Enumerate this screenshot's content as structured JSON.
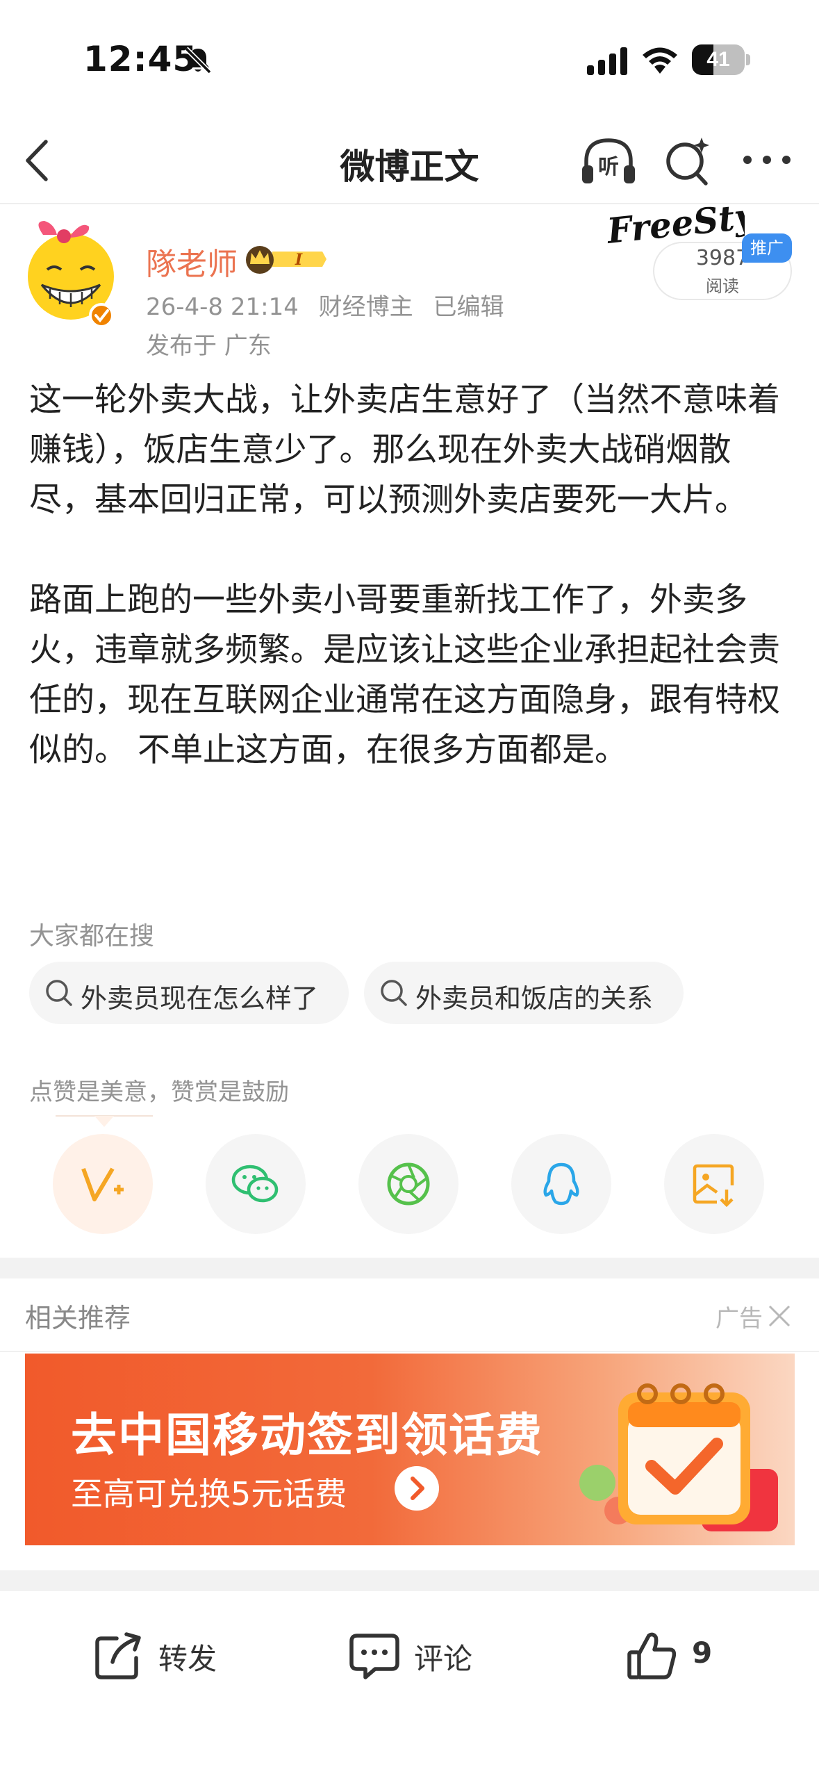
{
  "status_bar": {
    "time": "12:45",
    "battery": "41",
    "battery_level": 0.41,
    "icons": [
      "bell-off-icon",
      "cellular-signal-icon",
      "wifi-icon",
      "battery-icon"
    ]
  },
  "nav": {
    "title": "微博正文",
    "icons": [
      "back-icon",
      "listen-icon",
      "search-icon",
      "more-icon"
    ],
    "listen_glyph": "听"
  },
  "author": {
    "name": "隊老师",
    "vip_level": "I",
    "timestamp": "26-4-8 21:14",
    "category": "财经博主",
    "edited": "已编辑",
    "location": "发布于 广东"
  },
  "read_card": {
    "logo_text": "FreeStyle",
    "count": "3987",
    "label": "阅读",
    "promo": "推广"
  },
  "post": {
    "paragraphs": [
      "这一轮外卖大战，让外卖店生意好了（当然不意味着赚钱），饭店生意少了。那么现在外卖大战硝烟散尽，基本回归正常，可以预测外卖店要死一大片。",
      "路面上跑的一些外卖小哥要重新找工作了，外卖多火，违章就多频繁。是应该让这些企业承担起社会责任的，现在互联网企业通常在这方面隐身，跟有特权似的。 不单止这方面，在很多方面都是。"
    ]
  },
  "hot_search": {
    "title": "大家都在搜",
    "items": [
      "外卖员现在怎么样了",
      "外卖员和饭店的关系"
    ]
  },
  "reward": {
    "hint": "点赞是美意，赞赏是鼓励",
    "share_buttons": [
      "reward-icon",
      "wechat-icon",
      "moments-icon",
      "qq-icon",
      "save-image-icon"
    ]
  },
  "recommend": {
    "title": "相关推荐",
    "ad_label": "广告",
    "banner": {
      "headline": "去中国移动签到领话费",
      "subline": "至高可兑换5元话费"
    }
  },
  "actions": {
    "repost": "转发",
    "comment": "评论",
    "like_count": "9"
  },
  "colors": {
    "accent_orange": "#eb7350",
    "meta_gray": "#939393",
    "promo_blue": "#3d8ff0",
    "ad_orange": "#f15a2b"
  }
}
